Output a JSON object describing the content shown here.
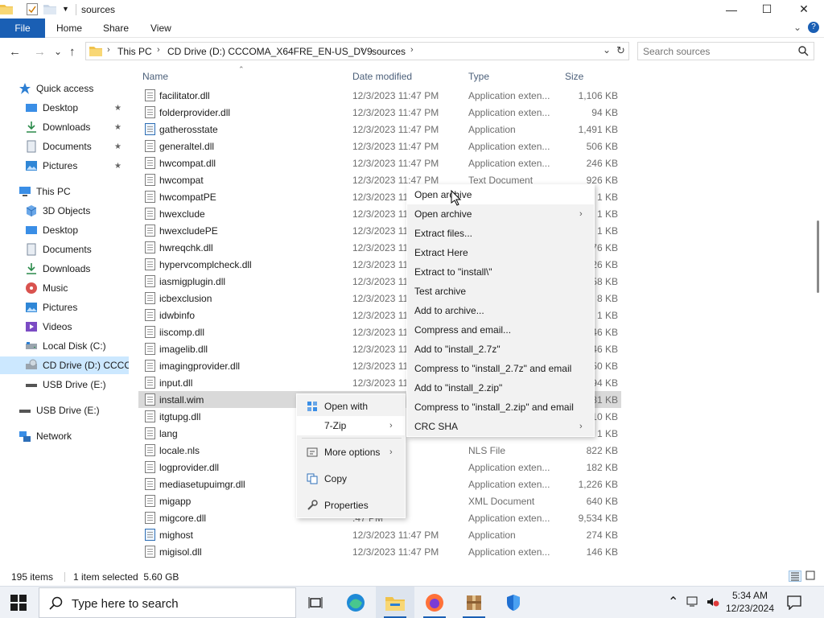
{
  "window": {
    "title": "sources",
    "min_glyph": "—",
    "max_glyph": "☐",
    "close_glyph": "✕"
  },
  "ribbon": {
    "tabs": [
      "File",
      "Home",
      "Share",
      "View"
    ],
    "expand_glyph": "⌄",
    "help_glyph": "?"
  },
  "nav": {
    "back": "←",
    "forward": "→",
    "recent": "⌄",
    "up": "↑",
    "breadcrumbs": [
      "This PC",
      "CD Drive (D:) CCCOMA_X64FRE_EN-US_DV9",
      "sources"
    ],
    "crumb_sep": "›",
    "dropdown": "⌄",
    "refresh": "↻"
  },
  "search": {
    "placeholder": "Search sources"
  },
  "sidebar": {
    "quick_access": "Quick access",
    "quick_items": [
      "Desktop",
      "Downloads",
      "Documents",
      "Pictures"
    ],
    "this_pc": "This PC",
    "pc_items": [
      "3D Objects",
      "Desktop",
      "Documents",
      "Downloads",
      "Music",
      "Pictures",
      "Videos",
      "Local Disk (C:)",
      "CD Drive (D:) CCCO",
      "USB Drive (E:)"
    ],
    "usb": "USB Drive (E:)",
    "network": "Network",
    "pin_glyph": "★"
  },
  "columns": {
    "name": "Name",
    "date": "Date modified",
    "type": "Type",
    "size": "Size"
  },
  "files": [
    {
      "name": "facilitator.dll",
      "date": "12/3/2023 11:47 PM",
      "type": "Application exten...",
      "size": "1,106 KB",
      "icon": "dll"
    },
    {
      "name": "folderprovider.dll",
      "date": "12/3/2023 11:47 PM",
      "type": "Application exten...",
      "size": "94 KB",
      "icon": "dll"
    },
    {
      "name": "gatherosstate",
      "date": "12/3/2023 11:47 PM",
      "type": "Application",
      "size": "1,491 KB",
      "icon": "app"
    },
    {
      "name": "generaltel.dll",
      "date": "12/3/2023 11:47 PM",
      "type": "Application exten...",
      "size": "506 KB",
      "icon": "dll"
    },
    {
      "name": "hwcompat.dll",
      "date": "12/3/2023 11:47 PM",
      "type": "Application exten...",
      "size": "246 KB",
      "icon": "dll"
    },
    {
      "name": "hwcompat",
      "date": "12/3/2023 11:47 PM",
      "type": "Text Document",
      "size": "926 KB",
      "icon": "txt"
    },
    {
      "name": "hwcompatPE",
      "date": "12/3/2023 11",
      "type": "",
      "size": "1 KB",
      "icon": "txt"
    },
    {
      "name": "hwexclude",
      "date": "12/3/2023 11",
      "type": "",
      "size": "1 KB",
      "icon": "txt"
    },
    {
      "name": "hwexcludePE",
      "date": "12/3/2023 11",
      "type": "",
      "size": "1 KB",
      "icon": "txt"
    },
    {
      "name": "hwreqchk.dll",
      "date": "12/3/2023 11",
      "type": "",
      "size": "76 KB",
      "icon": "dll"
    },
    {
      "name": "hypervcomplcheck.dll",
      "date": "12/3/2023 11",
      "type": "",
      "size": "26 KB",
      "icon": "dll"
    },
    {
      "name": "iasmigplugin.dll",
      "date": "12/3/2023 11",
      "type": "",
      "size": "58 KB",
      "icon": "dll"
    },
    {
      "name": "icbexclusion",
      "date": "12/3/2023 11",
      "type": "",
      "size": "8 KB",
      "icon": "txt"
    },
    {
      "name": "idwbinfo",
      "date": "12/3/2023 11",
      "type": "",
      "size": "1 KB",
      "icon": "txt"
    },
    {
      "name": "iiscomp.dll",
      "date": "12/3/2023 11",
      "type": "",
      "size": "46 KB",
      "icon": "dll"
    },
    {
      "name": "imagelib.dll",
      "date": "12/3/2023 11",
      "type": "",
      "size": "46 KB",
      "icon": "dll"
    },
    {
      "name": "imagingprovider.dll",
      "date": "12/3/2023 11",
      "type": "",
      "size": "50 KB",
      "icon": "dll"
    },
    {
      "name": "input.dll",
      "date": "12/3/2023 11",
      "type": "",
      "size": "94 KB",
      "icon": "dll"
    },
    {
      "name": "install.wim",
      "date": "",
      "type": "",
      "size": "81 KB",
      "icon": "txt"
    },
    {
      "name": "itgtupg.dll",
      "date": "",
      "type": "",
      "size": "10 KB",
      "icon": "dll"
    },
    {
      "name": "lang",
      "date": "",
      "type": "",
      "size": "1 KB",
      "icon": "txt"
    },
    {
      "name": "locale.nls",
      "date": ":47 PM",
      "type": "NLS File",
      "size": "822 KB",
      "icon": "txt"
    },
    {
      "name": "logprovider.dll",
      "date": ":47 PM",
      "type": "Application exten...",
      "size": "182 KB",
      "icon": "dll"
    },
    {
      "name": "mediasetupuimgr.dll",
      "date": ":47 PM",
      "type": "Application exten...",
      "size": "1,226 KB",
      "icon": "dll"
    },
    {
      "name": "migapp",
      "date": ":47 PM",
      "type": "XML Document",
      "size": "640 KB",
      "icon": "txt"
    },
    {
      "name": "migcore.dll",
      "date": ":47 PM",
      "type": "Application exten...",
      "size": "9,534 KB",
      "icon": "dll"
    },
    {
      "name": "mighost",
      "date": "12/3/2023 11:47 PM",
      "type": "Application",
      "size": "274 KB",
      "icon": "app"
    },
    {
      "name": "migisol.dll",
      "date": "12/3/2023 11:47 PM",
      "type": "Application exten...",
      "size": "146 KB",
      "icon": "dll"
    }
  ],
  "context_menu": {
    "items": [
      "Open with",
      "7-Zip",
      "More options",
      "Copy",
      "Properties"
    ],
    "submenu_glyph": "›"
  },
  "zip_menu": {
    "items": [
      "Open archive",
      "Open archive",
      "Extract files...",
      "Extract Here",
      "Extract to \"install\\\"",
      "Test archive",
      "Add to archive...",
      "Compress and email...",
      "Add to \"install_2.7z\"",
      "Compress to \"install_2.7z\" and email",
      "Add to \"install_2.zip\"",
      "Compress to \"install_2.zip\" and email",
      "CRC SHA"
    ],
    "submenu_glyph": "›"
  },
  "status": {
    "items_count": "195 items",
    "selection": "1 item selected  5.60 GB"
  },
  "taskbar": {
    "search_text": "Type here to search",
    "time": "5:34 AM",
    "date": "12/23/2024",
    "tray_up": "⌃"
  },
  "colors": {
    "accent": "#1a5fb4",
    "selection": "#cce8ff",
    "selected_row": "#d9d9d9",
    "menu_bg": "#f2f2f2"
  }
}
